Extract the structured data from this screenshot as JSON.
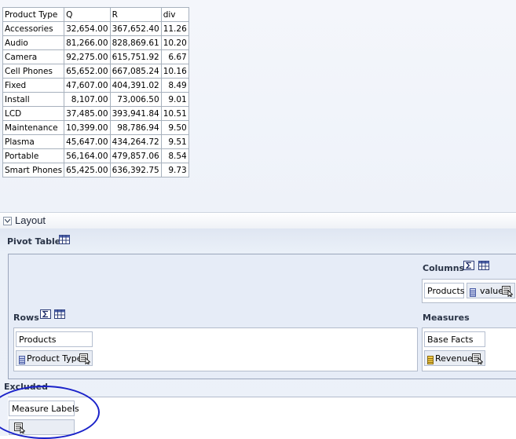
{
  "table": {
    "headers": [
      "Product Type",
      "Q",
      "R",
      "div"
    ],
    "rows": [
      [
        "Accessories",
        "32,654.00",
        "367,652.40",
        "11.26"
      ],
      [
        "Audio",
        "81,266.00",
        "828,869.61",
        "10.20"
      ],
      [
        "Camera",
        "92,275.00",
        "615,751.92",
        "6.67"
      ],
      [
        "Cell Phones",
        "65,652.00",
        "667,085.24",
        "10.16"
      ],
      [
        "Fixed",
        "47,607.00",
        "404,391.02",
        "8.49"
      ],
      [
        "Install",
        "8,107.00",
        "73,006.50",
        "9.01"
      ],
      [
        "LCD",
        "37,485.00",
        "393,941.84",
        "10.51"
      ],
      [
        "Maintenance",
        "10,399.00",
        "98,786.94",
        "9.50"
      ],
      [
        "Plasma",
        "45,647.00",
        "434,264.72",
        "9.51"
      ],
      [
        "Portable",
        "56,164.00",
        "479,857.06",
        "8.54"
      ],
      [
        "Smart Phones",
        "65,425.00",
        "636,392.75",
        "9.73"
      ]
    ]
  },
  "layout": {
    "title": "Layout",
    "pivot_table_label": "Pivot Table",
    "columns": {
      "label": "Columns",
      "chips": [
        "Products",
        "value"
      ]
    },
    "rows": {
      "label": "Rows",
      "chips": [
        "Products",
        "Product Type"
      ]
    },
    "measures": {
      "label": "Measures",
      "chips": [
        "Base Facts",
        "Revenue"
      ]
    },
    "excluded": {
      "label": "Excluded",
      "chips": [
        "Measure Labels"
      ]
    }
  },
  "colors": {
    "highlight": "#1a22c9",
    "panel_bg": "#e6ecf7"
  },
  "icons": [
    "collapse-icon",
    "sigma-icon",
    "pivot-grid-icon",
    "column-item-icon",
    "measure-item-icon",
    "properties-icon"
  ]
}
